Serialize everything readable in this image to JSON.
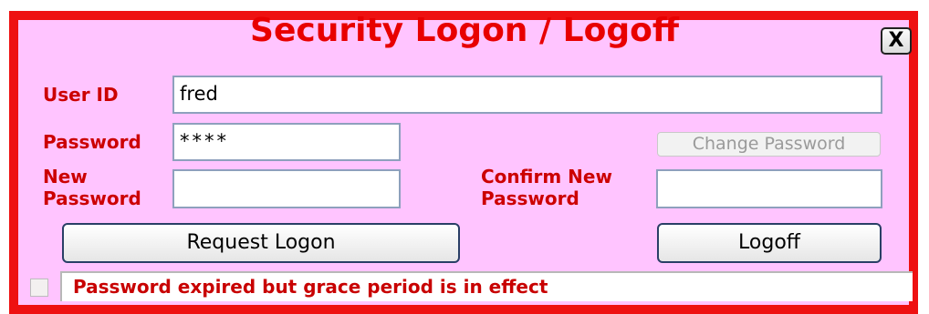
{
  "dialog": {
    "title": "Security Logon / Logoff",
    "close_label": "X",
    "labels": {
      "user_id": "User ID",
      "password": "Password",
      "new_password_line1": "New",
      "new_password_line2": "Password",
      "confirm_new_password_line1": "Confirm New",
      "confirm_new_password_line2": "Password"
    },
    "fields": {
      "user_id_value": "fred",
      "password_value": "****",
      "new_password_value": "",
      "confirm_new_password_value": ""
    },
    "buttons": {
      "change_password": "Change Password",
      "request_logon": "Request Logon",
      "logoff": "Logoff"
    },
    "status": {
      "message": "Password expired but grace period is in effect",
      "checkbox_checked": false
    }
  },
  "colors": {
    "border": "#ee1111",
    "background": "#ffc4ff",
    "label": "#cc0000",
    "title": "#e80000"
  }
}
